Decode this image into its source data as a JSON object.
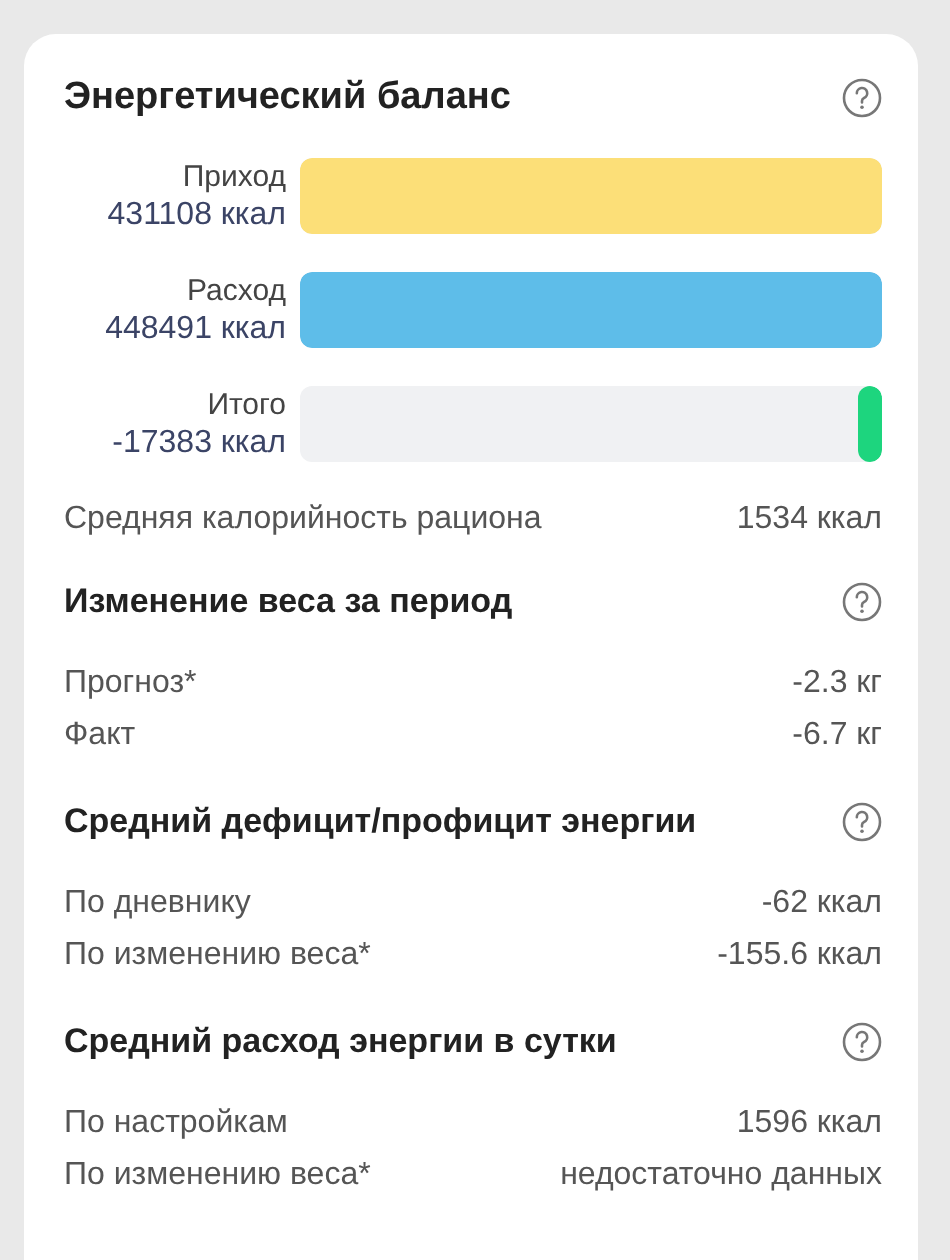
{
  "title": "Энергетический баланс",
  "bars": [
    {
      "label": "Приход",
      "value": "431108 ккал",
      "level": 1,
      "color": "#fcdf78"
    },
    {
      "label": "Расход",
      "value": "448491 ккал",
      "level": 1,
      "color": "#5ebde9"
    },
    {
      "label": "Итого",
      "value": "-17383 ккал",
      "level": 0.04,
      "negative": true,
      "color": "#1dd57e"
    }
  ],
  "summary": {
    "label": "Средняя калорийность рациона",
    "value": "1534 ккал"
  },
  "sections": [
    {
      "title": "Изменение веса за период",
      "rows": [
        {
          "label": "Прогноз*",
          "value": "-2.3 кг"
        },
        {
          "label": "Факт",
          "value": "-6.7 кг"
        }
      ]
    },
    {
      "title": "Средний дефицит/профицит энергии",
      "rows": [
        {
          "label": "По дневнику",
          "value": "-62 ккал"
        },
        {
          "label": "По изменению веса*",
          "value": "-155.6 ккал"
        }
      ]
    },
    {
      "title": "Средний расход энергии в сутки",
      "rows": [
        {
          "label": "По настройкам",
          "value": "1596 ккал"
        },
        {
          "label": "По изменению веса*",
          "value": "недостаточно данных"
        }
      ]
    }
  ]
}
